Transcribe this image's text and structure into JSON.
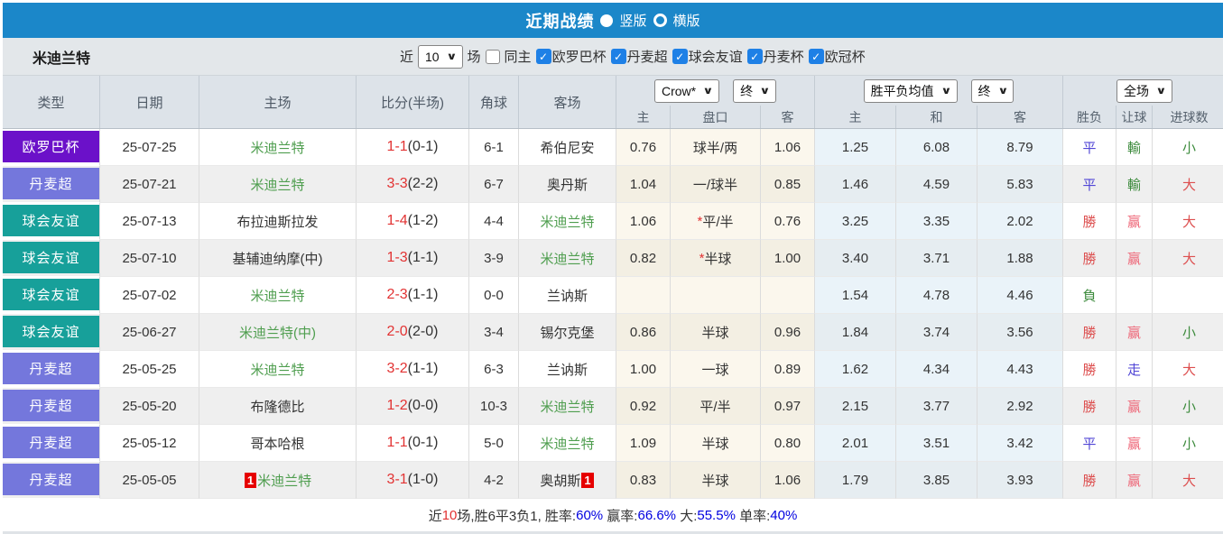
{
  "topbar": {
    "title": "近期战绩",
    "vertical_label": "竖版",
    "horizontal_label": "横版"
  },
  "filterbar": {
    "team_name": "米迪兰特",
    "near_label": "近",
    "near_value": "10",
    "games_label": "场",
    "same_home_label": "同主",
    "leagues": [
      "欧罗巴杯",
      "丹麦超",
      "球会友谊",
      "丹麦杯",
      "欧冠杯"
    ]
  },
  "header": {
    "cols": [
      "类型",
      "日期",
      "主场",
      "比分(半场)",
      "角球",
      "客场"
    ],
    "sub": [
      "主",
      "盘口",
      "客",
      "主",
      "和",
      "客",
      "胜负",
      "让球",
      "进球数"
    ],
    "bookmaker_select": "Crow*",
    "handicap_time_select": "终",
    "avg_select": "胜平负均值",
    "avg_time_select": "终",
    "scope_select": "全场"
  },
  "table": {
    "rows": [
      {
        "type": {
          "t": "欧罗巴杯",
          "c": "t-europa"
        },
        "date": "25-07-25",
        "home": {
          "t": "米迪兰特",
          "c": "team-self",
          "card": ""
        },
        "score_ft": "1-1",
        "score_ht": "(0-1)",
        "corner": "6-1",
        "away": {
          "t": "希伯尼安",
          "c": "team-other",
          "card": ""
        },
        "crow": {
          "home": "0.76",
          "star": "",
          "line": "球半/两",
          "away": "1.06"
        },
        "avg": {
          "home": "1.25",
          "draw": "6.08",
          "away": "8.79"
        },
        "res": {
          "t": "平",
          "c": "blue"
        },
        "let": {
          "t": "輸",
          "c": "green"
        },
        "goal": {
          "t": "小",
          "c": "green"
        }
      },
      {
        "type": {
          "t": "丹麦超",
          "c": "t-super"
        },
        "date": "25-07-21",
        "home": {
          "t": "米迪兰特",
          "c": "team-self",
          "card": ""
        },
        "score_ft": "3-3",
        "score_ht": "(2-2)",
        "corner": "6-7",
        "away": {
          "t": "奥丹斯",
          "c": "team-other",
          "card": ""
        },
        "crow": {
          "home": "1.04",
          "star": "",
          "line": "一/球半",
          "away": "0.85"
        },
        "avg": {
          "home": "1.46",
          "draw": "4.59",
          "away": "5.83"
        },
        "res": {
          "t": "平",
          "c": "blue"
        },
        "let": {
          "t": "輸",
          "c": "green"
        },
        "goal": {
          "t": "大",
          "c": "red"
        }
      },
      {
        "type": {
          "t": "球会友谊",
          "c": "t-friendly"
        },
        "date": "25-07-13",
        "home": {
          "t": "布拉迪斯拉发",
          "c": "team-other",
          "card": ""
        },
        "score_ft": "1-4",
        "score_ht": "(1-2)",
        "corner": "4-4",
        "away": {
          "t": "米迪兰特",
          "c": "team-self",
          "card": ""
        },
        "crow": {
          "home": "1.06",
          "star": "*",
          "line": "平/半",
          "away": "0.76"
        },
        "avg": {
          "home": "3.25",
          "draw": "3.35",
          "away": "2.02"
        },
        "res": {
          "t": "勝",
          "c": "red"
        },
        "let": {
          "t": "赢",
          "c": "pink"
        },
        "goal": {
          "t": "大",
          "c": "red"
        }
      },
      {
        "type": {
          "t": "球会友谊",
          "c": "t-friendly"
        },
        "date": "25-07-10",
        "home": {
          "t": "基辅迪纳摩(中)",
          "c": "team-other",
          "card": ""
        },
        "score_ft": "1-3",
        "score_ht": "(1-1)",
        "corner": "3-9",
        "away": {
          "t": "米迪兰特",
          "c": "team-self",
          "card": ""
        },
        "crow": {
          "home": "0.82",
          "star": "*",
          "line": "半球",
          "away": "1.00"
        },
        "avg": {
          "home": "3.40",
          "draw": "3.71",
          "away": "1.88"
        },
        "res": {
          "t": "勝",
          "c": "red"
        },
        "let": {
          "t": "赢",
          "c": "pink"
        },
        "goal": {
          "t": "大",
          "c": "red"
        }
      },
      {
        "type": {
          "t": "球会友谊",
          "c": "t-friendly"
        },
        "date": "25-07-02",
        "home": {
          "t": "米迪兰特",
          "c": "team-self",
          "card": ""
        },
        "score_ft": "2-3",
        "score_ht": "(1-1)",
        "corner": "0-0",
        "away": {
          "t": "兰讷斯",
          "c": "team-other",
          "card": ""
        },
        "crow": {
          "home": "",
          "star": "",
          "line": "",
          "away": ""
        },
        "avg": {
          "home": "1.54",
          "draw": "4.78",
          "away": "4.46"
        },
        "res": {
          "t": "負",
          "c": "green"
        },
        "let": {
          "t": "",
          "c": ""
        },
        "goal": {
          "t": "",
          "c": ""
        }
      },
      {
        "type": {
          "t": "球会友谊",
          "c": "t-friendly"
        },
        "date": "25-06-27",
        "home": {
          "t": "米迪兰特(中)",
          "c": "team-self",
          "card": ""
        },
        "score_ft": "2-0",
        "score_ht": "(2-0)",
        "corner": "3-4",
        "away": {
          "t": "锡尔克堡",
          "c": "team-other",
          "card": ""
        },
        "crow": {
          "home": "0.86",
          "star": "",
          "line": "半球",
          "away": "0.96"
        },
        "avg": {
          "home": "1.84",
          "draw": "3.74",
          "away": "3.56"
        },
        "res": {
          "t": "勝",
          "c": "red"
        },
        "let": {
          "t": "赢",
          "c": "pink"
        },
        "goal": {
          "t": "小",
          "c": "green"
        }
      },
      {
        "type": {
          "t": "丹麦超",
          "c": "t-super"
        },
        "date": "25-05-25",
        "home": {
          "t": "米迪兰特",
          "c": "team-self",
          "card": ""
        },
        "score_ft": "3-2",
        "score_ht": "(1-1)",
        "corner": "6-3",
        "away": {
          "t": "兰讷斯",
          "c": "team-other",
          "card": ""
        },
        "crow": {
          "home": "1.00",
          "star": "",
          "line": "一球",
          "away": "0.89"
        },
        "avg": {
          "home": "1.62",
          "draw": "4.34",
          "away": "4.43"
        },
        "res": {
          "t": "勝",
          "c": "red"
        },
        "let": {
          "t": "走",
          "c": "blue"
        },
        "goal": {
          "t": "大",
          "c": "red"
        }
      },
      {
        "type": {
          "t": "丹麦超",
          "c": "t-super"
        },
        "date": "25-05-20",
        "home": {
          "t": "布隆德比",
          "c": "team-other",
          "card": ""
        },
        "score_ft": "1-2",
        "score_ht": "(0-0)",
        "corner": "10-3",
        "away": {
          "t": "米迪兰特",
          "c": "team-self",
          "card": ""
        },
        "crow": {
          "home": "0.92",
          "star": "",
          "line": "平/半",
          "away": "0.97"
        },
        "avg": {
          "home": "2.15",
          "draw": "3.77",
          "away": "2.92"
        },
        "res": {
          "t": "勝",
          "c": "red"
        },
        "let": {
          "t": "赢",
          "c": "pink"
        },
        "goal": {
          "t": "小",
          "c": "green"
        }
      },
      {
        "type": {
          "t": "丹麦超",
          "c": "t-super"
        },
        "date": "25-05-12",
        "home": {
          "t": "哥本哈根",
          "c": "team-other",
          "card": ""
        },
        "score_ft": "1-1",
        "score_ht": "(0-1)",
        "corner": "5-0",
        "away": {
          "t": "米迪兰特",
          "c": "team-self",
          "card": ""
        },
        "crow": {
          "home": "1.09",
          "star": "",
          "line": "半球",
          "away": "0.80"
        },
        "avg": {
          "home": "2.01",
          "draw": "3.51",
          "away": "3.42"
        },
        "res": {
          "t": "平",
          "c": "blue"
        },
        "let": {
          "t": "赢",
          "c": "pink"
        },
        "goal": {
          "t": "小",
          "c": "green"
        }
      },
      {
        "type": {
          "t": "丹麦超",
          "c": "t-super"
        },
        "date": "25-05-05",
        "home": {
          "t": "米迪兰特",
          "c": "team-self",
          "card": "1"
        },
        "score_ft": "3-1",
        "score_ht": "(1-0)",
        "corner": "4-2",
        "away": {
          "t": "奥胡斯",
          "c": "team-other",
          "card": "1"
        },
        "crow": {
          "home": "0.83",
          "star": "",
          "line": "半球",
          "away": "1.06"
        },
        "avg": {
          "home": "1.79",
          "draw": "3.85",
          "away": "3.93"
        },
        "res": {
          "t": "勝",
          "c": "red"
        },
        "let": {
          "t": "赢",
          "c": "pink"
        },
        "goal": {
          "t": "大",
          "c": "red"
        }
      }
    ]
  },
  "summary": {
    "p1": "近",
    "p2": "10",
    "p3": "场,胜6平3负1, 胜率:",
    "p4": "60%",
    "p5": " 赢率:",
    "p6": "66.6%",
    "p7": " 大:",
    "p8": "55.5%",
    "p9": " 单率:",
    "p10": "40%"
  },
  "colors": {
    "topbar_blue": "#1b87c9",
    "europa_purple": "#6b11c9",
    "danish_super_blue": "#7477dc",
    "friendly_teal": "#17a09a",
    "win_red": "#dd4f4f",
    "handicap_win_pink": "#ee6677",
    "lose_green": "#3d8b3d",
    "draw_blue": "#5146d6",
    "team_green": "#4f9e4f",
    "score_red": "#e23333",
    "rate_blue": "#0000e0",
    "checkbox_blue": "#1e80e6",
    "red_card": "#e60000"
  }
}
